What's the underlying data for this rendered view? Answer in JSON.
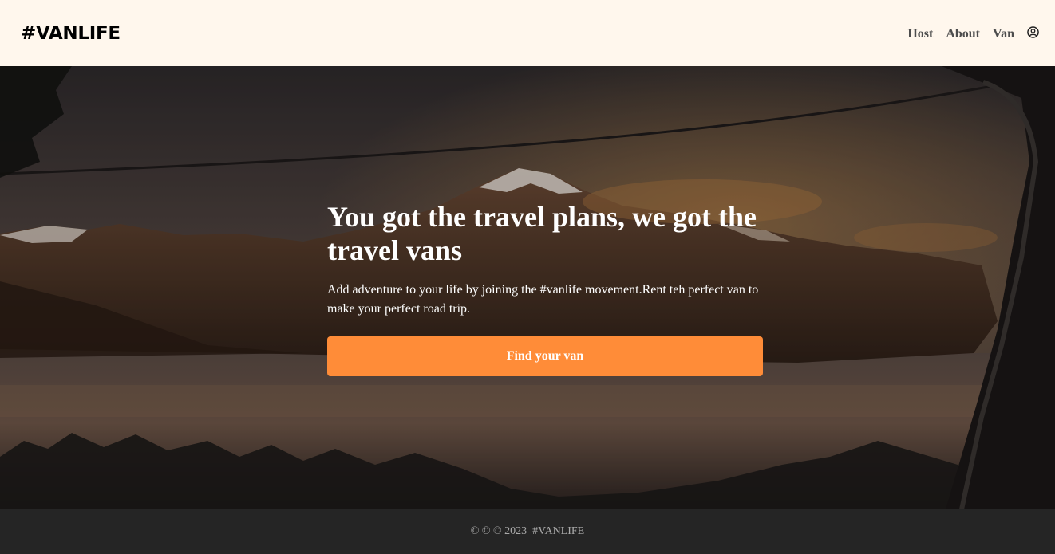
{
  "header": {
    "logo": "#VANLIFE",
    "nav": [
      {
        "label": "Host"
      },
      {
        "label": "About"
      },
      {
        "label": "Van"
      }
    ],
    "user_icon": "user-circle-icon"
  },
  "hero": {
    "title": "You got the travel plans, we got the travel vans",
    "text": "Add adventure to your life by joining the #vanlife movement.Rent teh perfect van to make your perfect road trip.",
    "cta_label": "Find your van",
    "background": "mountain-lake-photo"
  },
  "footer": {
    "text": "© © © 2023  #VANLIFE"
  },
  "colors": {
    "header_bg": "#FFF7ED",
    "accent": "#FF8C38",
    "footer_bg": "#252525",
    "nav_text": "#4D4D4D"
  }
}
